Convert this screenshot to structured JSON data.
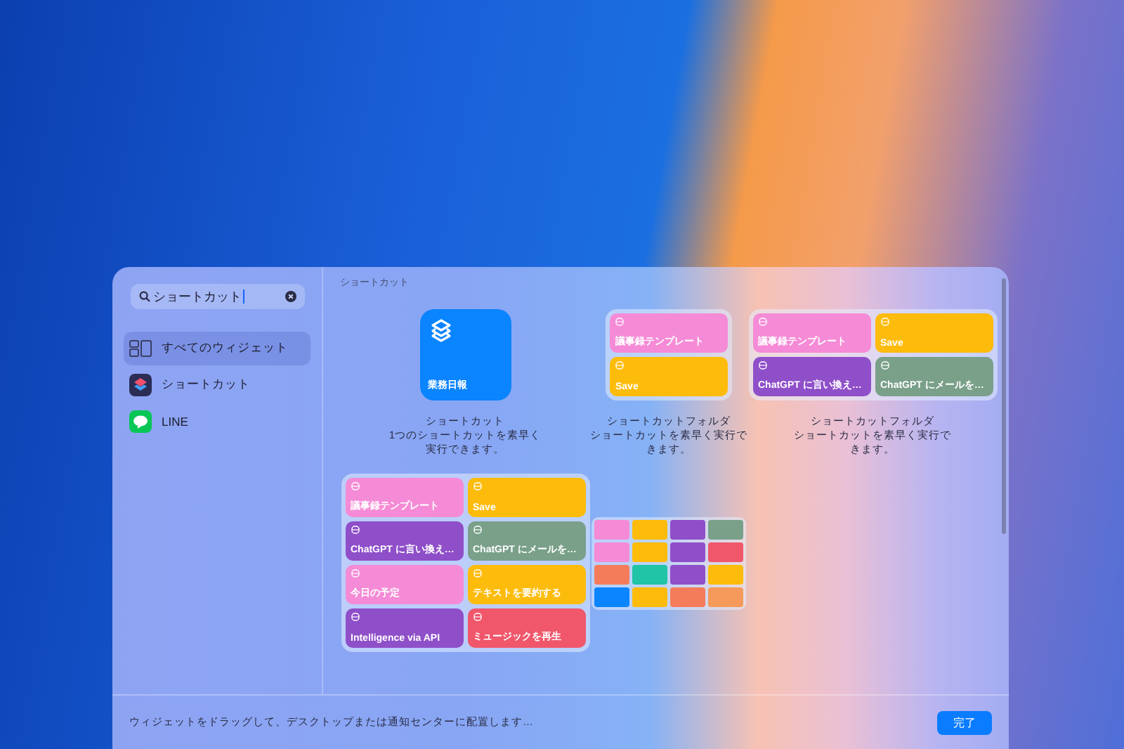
{
  "search": {
    "value": "ショートカット"
  },
  "sidebar": {
    "items": [
      {
        "label": "すべてのウィジェット",
        "kind": "all",
        "selected": true
      },
      {
        "label": "ショートカット",
        "kind": "shortcuts",
        "selected": false
      },
      {
        "label": "LINE",
        "kind": "line",
        "selected": false
      }
    ]
  },
  "section_title": "ショートカット",
  "widgets": [
    {
      "kind": "small",
      "label": "業務日報",
      "title": "ショートカット",
      "description": "1つのショートカットを素早く実行できます。"
    },
    {
      "kind": "folder",
      "title": "ショートカットフォルダ",
      "description": "ショートカットを素早く実行できます。",
      "tiles": [
        {
          "label": "議事録テンプレート",
          "color": "#f58bd6"
        },
        {
          "label": "Save",
          "color": "#fdbb0b"
        }
      ]
    },
    {
      "kind": "folder",
      "title": "ショートカットフォルダ",
      "description": "ショートカットを素早く実行できます。",
      "tiles": [
        {
          "label": "議事録テンプレート",
          "color": "#f58bd6"
        },
        {
          "label": "Save",
          "color": "#fdbb0b"
        },
        {
          "label": "ChatGPT に言い換え…",
          "color": "#8f4fc9"
        },
        {
          "label": "ChatGPT にメールを…",
          "color": "#7aa08a"
        }
      ]
    },
    {
      "kind": "folder",
      "tiles": [
        {
          "label": "議事録テンプレート",
          "color": "#f58bd6"
        },
        {
          "label": "Save",
          "color": "#fdbb0b"
        },
        {
          "label": "ChatGPT に言い換え…",
          "color": "#8f4fc9"
        },
        {
          "label": "ChatGPT にメールを…",
          "color": "#7aa08a"
        },
        {
          "label": "今日の予定",
          "color": "#f58bd6"
        },
        {
          "label": "テキストを要約する",
          "color": "#fdbb0b"
        },
        {
          "label": "Intelligence via API",
          "color": "#8f4fc9"
        },
        {
          "label": "ミュージックを再生",
          "color": "#f0576b"
        }
      ]
    },
    {
      "kind": "grid",
      "tiles": [
        {
          "color": "#f58bd6"
        },
        {
          "color": "#fdbb0b"
        },
        {
          "color": "#8f4fc9"
        },
        {
          "color": "#7aa08a"
        },
        {
          "color": "#f58bd6"
        },
        {
          "color": "#fdbb0b"
        },
        {
          "color": "#8f4fc9"
        },
        {
          "color": "#f0576b"
        },
        {
          "color": "#f47c5b"
        },
        {
          "color": "#21c4a4"
        },
        {
          "color": "#8f4fc9"
        },
        {
          "color": "#fdbb0b"
        },
        {
          "color": "#0a84ff"
        },
        {
          "color": "#fdbb0b"
        },
        {
          "color": "#f47c5b"
        },
        {
          "color": "#f59a5a"
        }
      ]
    }
  ],
  "footer": {
    "hint": "ウィジェットをドラッグして、デスクトップまたは通知センターに配置します…",
    "done_button": "完了"
  }
}
